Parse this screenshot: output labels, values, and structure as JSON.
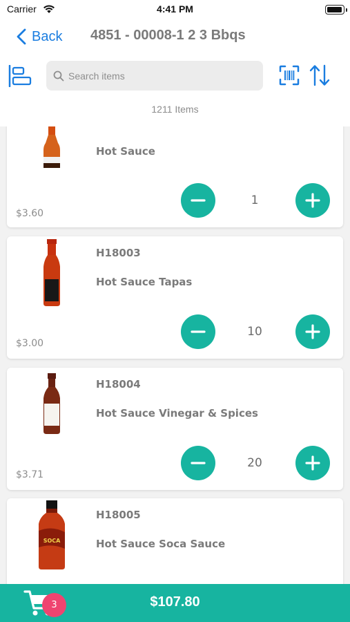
{
  "status_bar": {
    "carrier": "Carrier",
    "time": "4:41 PM"
  },
  "nav": {
    "back_label": "Back",
    "title": "4851 - 00008-1 2 3 Bbqs"
  },
  "search": {
    "placeholder": "Search items"
  },
  "items_count": "1211 Items",
  "products": [
    {
      "sku": "",
      "name": "Hot Sauce",
      "price": "$3.60",
      "quantity": "1"
    },
    {
      "sku": "H18003",
      "name": "Hot Sauce Tapas",
      "price": "$3.00",
      "quantity": "10"
    },
    {
      "sku": "H18004",
      "name": "Hot Sauce Vinegar & Spices",
      "price": "$3.71",
      "quantity": "20"
    },
    {
      "sku": "H18005",
      "name": "Hot Sauce Soca Sauce",
      "price": "",
      "quantity": ""
    }
  ],
  "bottle_label_text": "SOCA",
  "cart": {
    "badge_count": "3",
    "total": "$107.80"
  },
  "colors": {
    "accent": "#17b4a0",
    "link": "#1a7de0",
    "badge": "#ef4470"
  },
  "icons": [
    "wifi-icon",
    "battery-icon",
    "chevron-left-icon",
    "layout-toggle-icon",
    "search-icon",
    "barcode-scan-icon",
    "sort-icon",
    "minus-icon",
    "plus-icon",
    "cart-icon"
  ]
}
